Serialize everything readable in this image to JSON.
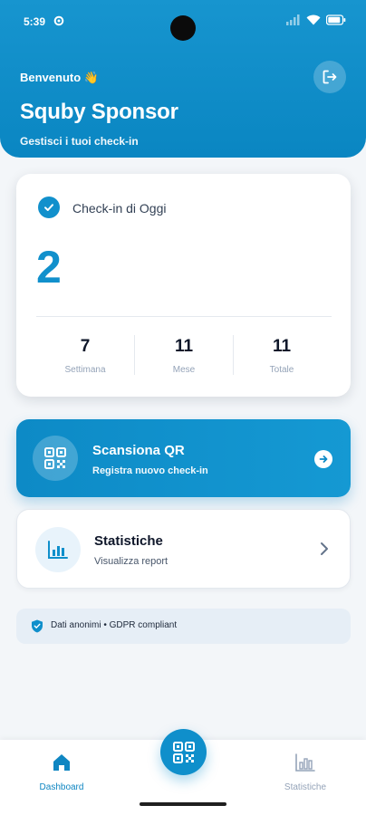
{
  "status_bar": {
    "time": "5:39"
  },
  "header": {
    "welcome": "Benvenuto 👋",
    "title": "Squby Sponsor",
    "subtitle": "Gestisci i tuoi check-in"
  },
  "today_card": {
    "label": "Check-in di Oggi",
    "value": "2",
    "stats": [
      {
        "value": "7",
        "label": "Settimana"
      },
      {
        "value": "11",
        "label": "Mese"
      },
      {
        "value": "11",
        "label": "Totale"
      }
    ]
  },
  "scan_card": {
    "title": "Scansiona QR",
    "subtitle": "Registra nuovo check-in"
  },
  "stats_card": {
    "title": "Statistiche",
    "subtitle": "Visualizza report"
  },
  "gdpr": {
    "text": "Dati anonimi • GDPR compliant"
  },
  "bottom_nav": {
    "items": [
      {
        "label": "Dashboard",
        "icon": "home-icon",
        "active": true
      },
      {
        "label": "Statistiche",
        "icon": "bar-chart-icon",
        "active": false
      }
    ],
    "fab_icon": "qr-code-icon"
  },
  "colors": {
    "primary": "#0f8fcb",
    "header": "#1795cf",
    "background": "#f3f6f9",
    "text_dark": "#0f172a",
    "text_muted": "#94a3b8"
  }
}
